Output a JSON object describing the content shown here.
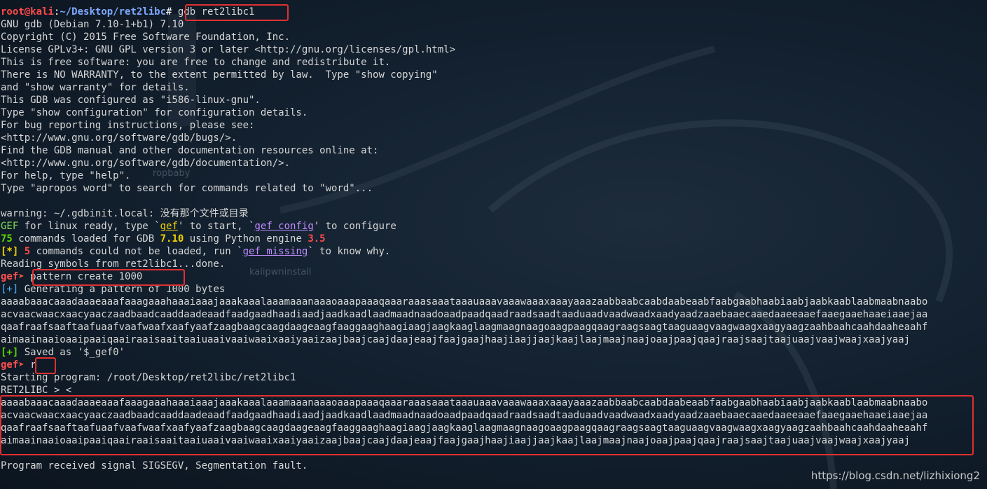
{
  "prompt": {
    "user": "root",
    "at": "@",
    "host": "kali",
    "colon": ":",
    "path": "~/Desktop/ret2libc",
    "hash": "#",
    "command": "gdb ret2libc1"
  },
  "banner": [
    "GNU gdb (Debian 7.10-1+b1) 7.10",
    "Copyright (C) 2015 Free Software Foundation, Inc.",
    "License GPLv3+: GNU GPL version 3 or later <http://gnu.org/licenses/gpl.html>",
    "This is free software: you are free to change and redistribute it.",
    "There is NO WARRANTY, to the extent permitted by law.  Type \"show copying\"",
    "and \"show warranty\" for details.",
    "This GDB was configured as \"i586-linux-gnu\".",
    "Type \"show configuration\" for configuration details.",
    "For bug reporting instructions, please see:",
    "<http://www.gnu.org/software/gdb/bugs/>.",
    "Find the GDB manual and other documentation resources online at:",
    "<http://www.gnu.org/software/gdb/documentation/>.",
    "For help, type \"help\".",
    "Type \"apropos word\" to search for commands related to \"word\"..."
  ],
  "warning_line": "warning: ~/.gdbinit.local: 没有那个文件或目录",
  "gef_ready": {
    "gef": "GEF",
    "t1": " for linux ready, type `",
    "cmd1": "gef",
    "t2": "' to start, `",
    "cmd2": "gef config",
    "t3": "' to configure"
  },
  "loaded": {
    "count": "75",
    "t1": " commands loaded for GDB ",
    "gdb_ver": "7.10",
    "t2": " using Python engine ",
    "py_ver": "3.5"
  },
  "failed": {
    "tag": "[*]",
    "count": " 5",
    "t1": " commands could not be loaded, run `",
    "cmd": "gef missing",
    "t2": "` to know why."
  },
  "reading": "Reading symbols from ret2libc1...done.",
  "gef_prompt": "gef➤ ",
  "cmd_pattern": "pattern create 1000",
  "generating": {
    "tag": "[+]",
    "text": " Generating a pattern of 1000 bytes"
  },
  "pattern_lines": [
    "aaaabaaacaaadaaaeaaafaaagaaahaaaiaaajaaakaaalaaamaaanaaaoaaapaaaqaaaraaasaaataaauaaavaaawaaaxaaayaaazaabbaabcaabdaabeaabfaabgaabhaabiaabjaabkaablaabmaabnaabo",
    "acvaacwaacxaacyaaczaadbaadcaaddaadeaadfaadgaadhaadiaadjaadkaadlaadmaadnaadoaadpaadqaadraadsaadtaaduaadvaadwaadxaadyaadzaaebaaecaaedaaeeaaefaaegaaehaaeiaaejaa",
    "qaafraafsaaftaafuaafvaafwaafxaafyaafzaagbaagcaagdaageaagfaaggaaghaagiaagjaagkaaglaagmaagnaagoaagpaagqaagraagsaagtaaguaagvaagwaagxaagyaagzaahbaahcaahdaaheaahf",
    "aimaainaaioaaipaaiqaairaaisaaitaaiuaaivaaiwaaixaaiyaaizaajbaajcaajdaajeaajfaajgaajhaajiaajjaajkaajlaajmaajnaajoaajpaajqaajraajsaajtaajuaajvaajwaajxaajyaaj"
  ],
  "saved": {
    "tag": "[+]",
    "text": " Saved as '$_gef0'"
  },
  "cmd_run": "r",
  "starting": "Starting program: /root/Desktop/ret2libc/ret2libc1",
  "program_out": "RET2LIBC >_<",
  "segv": "Program received signal SIGSEGV, Segmentation fault.",
  "desktop_labels": {
    "ropbaby": "ropbaby",
    "kalipwn": "kalipwninstall"
  },
  "watermark": "https://blog.csdn.net/lizhixiong2",
  "colors": {
    "prompt_red": "#ff4a4a",
    "path_blue": "#7ea8ff",
    "highlight_box": "#e03030",
    "gef_green": "#5fd700",
    "gef_yellow": "#f0d000"
  }
}
